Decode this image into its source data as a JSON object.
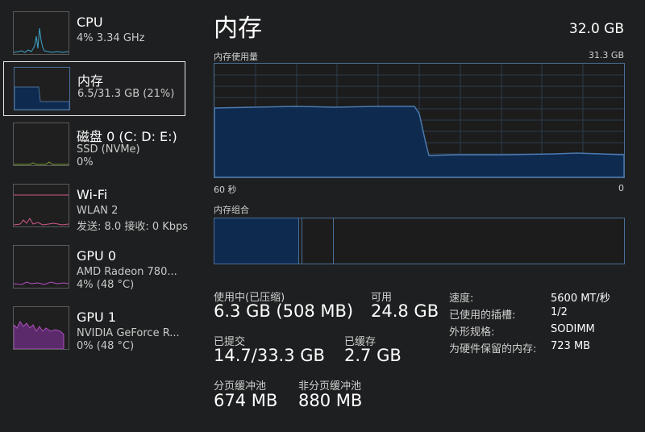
{
  "sidebar": {
    "items": [
      {
        "title": "CPU",
        "line1": "4% 3.34 GHz",
        "line2": ""
      },
      {
        "title": "内存",
        "line1": "6.5/31.3 GB (21%)",
        "line2": ""
      },
      {
        "title": "磁盘 0 (C: D: E:)",
        "line1": "SSD (NVMe)",
        "line2": "0%"
      },
      {
        "title": "Wi-Fi",
        "line1": "WLAN 2",
        "line2": "发送: 8.0 接收: 0 Kbps"
      },
      {
        "title": "GPU 0",
        "line1": "AMD Radeon 780...",
        "line2": "4% (48 °C)"
      },
      {
        "title": "GPU 1",
        "line1": "NVIDIA GeForce R...",
        "line2": "0% (48 °C)"
      }
    ]
  },
  "main": {
    "title": "内存",
    "total": "32.0 GB",
    "usage_graph": {
      "label": "内存使用量",
      "max_label": "31.3 GB",
      "time_left": "60 秒",
      "time_right": "0"
    },
    "composition_label": "内存组合",
    "stats": {
      "in_use_label": "使用中(已压缩)",
      "in_use_value": "6.3 GB (508 MB)",
      "available_label": "可用",
      "available_value": "24.8 GB",
      "committed_label": "已提交",
      "committed_value": "14.7/33.3 GB",
      "cached_label": "已缓存",
      "cached_value": "2.7 GB",
      "paged_pool_label": "分页缓冲池",
      "paged_pool_value": "674 MB",
      "nonpaged_pool_label": "非分页缓冲池",
      "nonpaged_pool_value": "880 MB"
    },
    "specs": {
      "speed_label": "速度:",
      "speed_value": "5600 MT/秒",
      "slots_label": "已使用的插槽:",
      "slots_value": "1/2",
      "form_factor_label": "外形规格:",
      "form_factor_value": "SODIMM",
      "reserved_label": "为硬件保留的内存:",
      "reserved_value": "723 MB"
    }
  },
  "colors": {
    "background": "#1e1f20",
    "memory_accent": "#4a6f9a",
    "memory_fill": "#0f2a4f",
    "cpu_line": "#3ea3c8",
    "disk_line": "#7a9a3a",
    "wifi_line": "#d05a8a",
    "gpu0_line": "#b050c0",
    "gpu1_fill": "#5a2a6a"
  }
}
